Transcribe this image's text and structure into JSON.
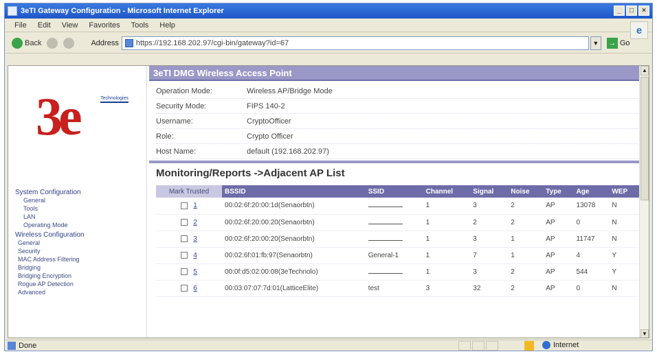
{
  "window": {
    "title": "3eTI Gateway Configuration - Microsoft Internet Explorer",
    "controls": {
      "minimize": "_",
      "maximize": "□",
      "close": "×"
    }
  },
  "menu": [
    "File",
    "Edit",
    "View",
    "Favorites",
    "Tools",
    "Help"
  ],
  "toolbar": {
    "back": "Back",
    "address_label": "Address",
    "address_value": "https://192.168.202.97/cgi-bin/gateway?id=67",
    "go": "Go"
  },
  "sidebar": {
    "logo_text": "3e",
    "logo_sub": "Technologies",
    "sections": [
      {
        "label": "System Configuration",
        "items": [
          "General",
          "Tools",
          "LAN",
          "Operating Mode"
        ]
      },
      {
        "label": "Wireless Configuration",
        "items": [
          "General",
          "Security",
          "MAC Address Filtering",
          "Bridging",
          "Bridging Encryption",
          "Rogue AP Detection",
          "Advanced"
        ]
      }
    ]
  },
  "header": {
    "title": "3eTI DMG Wireless Access Point"
  },
  "info": [
    {
      "k": "Operation Mode:",
      "v": "Wireless AP/Bridge Mode"
    },
    {
      "k": "Security Mode:",
      "v": "FIPS 140-2"
    },
    {
      "k": "Username:",
      "v": "CryptoOfficer"
    },
    {
      "k": "Role:",
      "v": "Crypto Officer"
    },
    {
      "k": "Host Name:",
      "v": "default (192.168.202.97)"
    }
  ],
  "section_title": "Monitoring/Reports ->Adjacent AP List",
  "table": {
    "columns": [
      "Mark Trusted",
      "BSSID",
      "SSID",
      "Channel",
      "Signal",
      "Noise",
      "Type",
      "Age",
      "WEP"
    ],
    "rows": [
      {
        "num": "1",
        "bssid": "00:02:6f:20:00:1d(Senaorbtn)",
        "ssid": "",
        "channel": "1",
        "signal": "3",
        "noise": "2",
        "type": "AP",
        "age": "13078",
        "wep": "N"
      },
      {
        "num": "2",
        "bssid": "00:02:6f:20:00:20(Senaorbtn)",
        "ssid": "",
        "channel": "1",
        "signal": "2",
        "noise": "2",
        "type": "AP",
        "age": "0",
        "wep": "N"
      },
      {
        "num": "3",
        "bssid": "00:02:6f:20:00:20(Senaorbtn)",
        "ssid": "",
        "channel": "1",
        "signal": "3",
        "noise": "1",
        "type": "AP",
        "age": "11747",
        "wep": "N"
      },
      {
        "num": "4",
        "bssid": "00:02:6f:01:fb:97(Senaorbtn)",
        "ssid": "General-1",
        "channel": "1",
        "signal": "7",
        "noise": "1",
        "type": "AP",
        "age": "4",
        "wep": "Y"
      },
      {
        "num": "5",
        "bssid": "00:0f:d5:02:00:08(3eTechnolo)",
        "ssid": "",
        "channel": "1",
        "signal": "3",
        "noise": "2",
        "type": "AP",
        "age": "544",
        "wep": "Y"
      },
      {
        "num": "6",
        "bssid": "00:03:07:07:7d:01(LatticeElite)",
        "ssid": "test",
        "channel": "3",
        "signal": "32",
        "noise": "2",
        "type": "AP",
        "age": "0",
        "wep": "N"
      }
    ]
  },
  "status": {
    "left": "Done",
    "zone": "Internet"
  }
}
